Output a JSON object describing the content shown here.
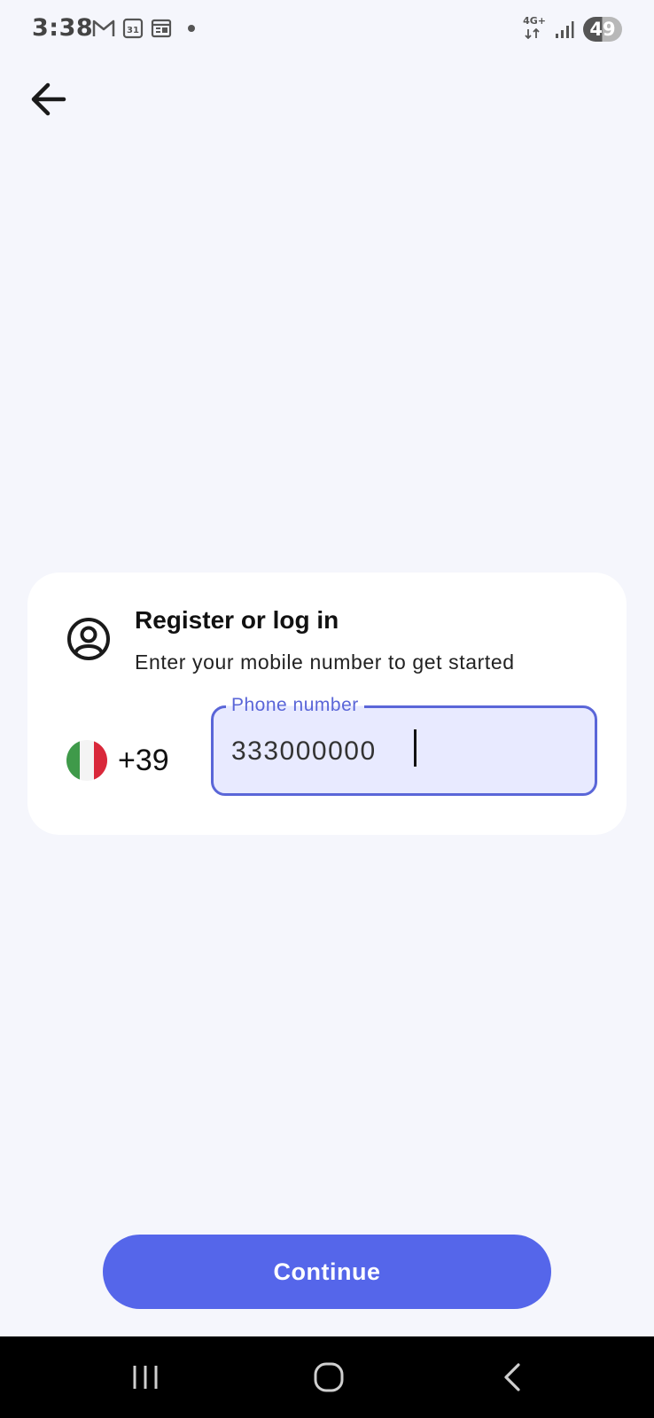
{
  "status_bar": {
    "time": "3:38",
    "left_icons": [
      "gmail-icon",
      "calendar-icon",
      "news-icon"
    ],
    "network_label": "4G+",
    "battery": "49"
  },
  "header": {
    "back_icon": "arrow-left-icon"
  },
  "card": {
    "icon": "user-circle-icon",
    "title": "Register or log in",
    "subtitle": "Enter your mobile number to get started",
    "country": {
      "flag": "italy-flag-icon",
      "code": "+39"
    },
    "phone_field": {
      "label": "Phone number",
      "value": "333000000"
    }
  },
  "continue_button": {
    "label": "Continue"
  },
  "colors": {
    "accent": "#5566ea",
    "field_border": "#5a66d8",
    "field_bg": "#e8eaff",
    "page_bg": "#f5f6fc"
  },
  "nav_bar": {
    "buttons": [
      "recents-icon",
      "home-icon",
      "back-nav-icon"
    ]
  }
}
